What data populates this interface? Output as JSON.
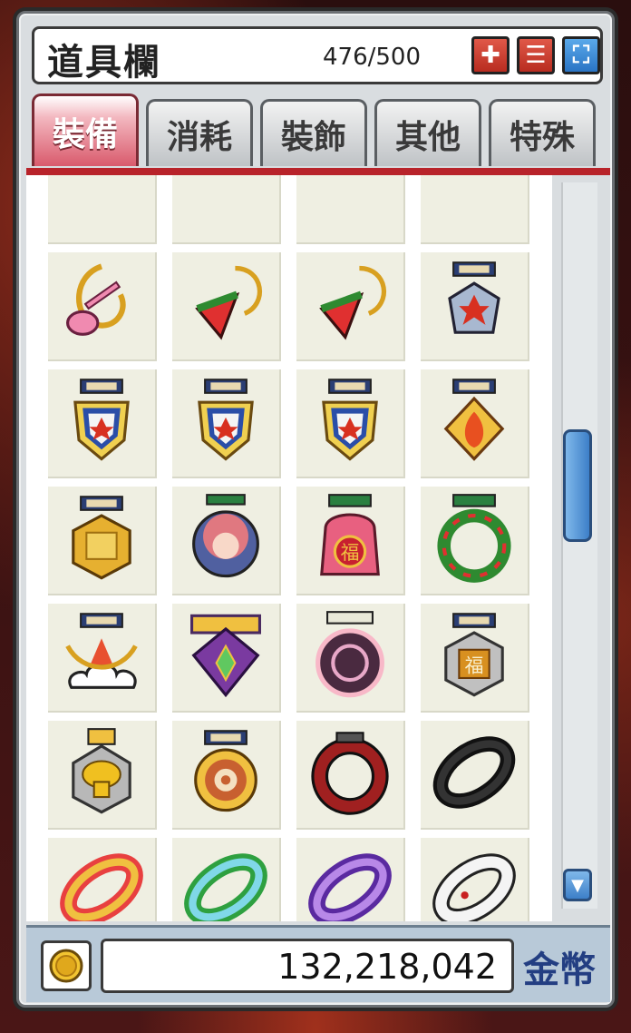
{
  "window": {
    "title": "道具欄",
    "slot_count": "476/500",
    "buttons": [
      {
        "name": "expand-button",
        "glyph": "✚"
      },
      {
        "name": "menu-button",
        "glyph": "☰"
      },
      {
        "name": "fullscreen-button",
        "glyph": "⛶"
      }
    ]
  },
  "tabs": [
    {
      "label": "裝備",
      "active": true
    },
    {
      "label": "消耗",
      "active": false
    },
    {
      "label": "裝飾",
      "active": false
    },
    {
      "label": "其他",
      "active": false
    },
    {
      "label": "特殊",
      "active": false
    }
  ],
  "items": [
    {
      "name": "partial-item-1",
      "icon": "armor"
    },
    {
      "name": "partial-item-2",
      "icon": "armor-red"
    },
    {
      "name": "partial-item-3",
      "icon": "silver-ring"
    },
    {
      "name": "partial-item-4",
      "icon": "silver-ring"
    },
    {
      "name": "guitar-pendant",
      "icon": "guitar"
    },
    {
      "name": "watermelon-earring-1",
      "icon": "watermelon"
    },
    {
      "name": "watermelon-earring-2",
      "icon": "watermelon"
    },
    {
      "name": "maple-medal-silver",
      "icon": "medal-maple-silver"
    },
    {
      "name": "maple-medal-blue",
      "icon": "medal-maple"
    },
    {
      "name": "maple-medal-wings",
      "icon": "medal-maple"
    },
    {
      "name": "maple-medal-laurel",
      "icon": "medal-maple"
    },
    {
      "name": "flame-medal",
      "icon": "flame"
    },
    {
      "name": "gold-medal",
      "icon": "gold-medal"
    },
    {
      "name": "doll-medal",
      "icon": "doll"
    },
    {
      "name": "fortune-pouch",
      "icon": "fortune-pouch"
    },
    {
      "name": "wreath-medal",
      "icon": "wreath"
    },
    {
      "name": "cloud-medal",
      "icon": "cloud"
    },
    {
      "name": "emblem-medal",
      "icon": "emblem"
    },
    {
      "name": "purple-orb-medal",
      "icon": "orb"
    },
    {
      "name": "fortune-medal",
      "icon": "fortune-medal"
    },
    {
      "name": "mushroom-medal",
      "icon": "mushroom"
    },
    {
      "name": "target-medal",
      "icon": "target"
    },
    {
      "name": "red-ring",
      "icon": "ring-red"
    },
    {
      "name": "black-ring",
      "icon": "ring-black"
    },
    {
      "name": "rainbow-ring",
      "icon": "ring-rainbow"
    },
    {
      "name": "green-ring",
      "icon": "ring-green"
    },
    {
      "name": "purple-ring",
      "icon": "ring-purple"
    },
    {
      "name": "white-ring",
      "icon": "ring-white"
    }
  ],
  "footer": {
    "money": "132,218,042",
    "money_label": "金幣",
    "coin_icon": "gold-coin-icon"
  },
  "colors": {
    "accent_red": "#b8232a",
    "tab_active": "#d95a6c",
    "scroll_blue": "#3d7fc8",
    "money_label": "#233e82"
  }
}
